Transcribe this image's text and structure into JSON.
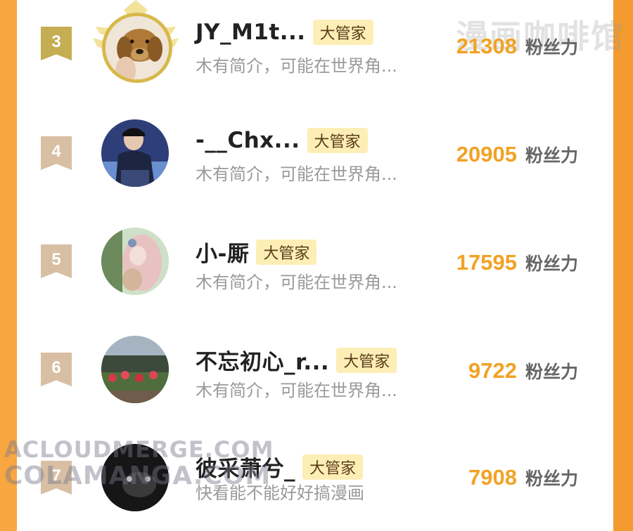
{
  "watermarks": {
    "top": "漫画咖啡馆",
    "bottom_line1": "ACLOUDMERGE.COM",
    "bottom_line2": "COLAMANGA.COM"
  },
  "fan_label": "粉丝力",
  "tag_label": "大管家",
  "colors": {
    "accent": "#f2a223",
    "gold_frame": "#d7b84b",
    "rank_badge": "#d8bfa4",
    "tag_bg": "#fdeeb6"
  },
  "rows": [
    {
      "rank": "3",
      "name": "JY_M1t...",
      "bio": "木有简介，可能在世界角...",
      "count": "21308",
      "avatar": "dog-photo"
    },
    {
      "rank": "4",
      "name": "-__Chx...",
      "bio": "木有简介，可能在世界角...",
      "count": "20905",
      "avatar": "person-cap-photo"
    },
    {
      "rank": "5",
      "name": "小-厮",
      "bio": "木有简介，可能在世界角...",
      "count": "17595",
      "avatar": "pink-hair-photo"
    },
    {
      "rank": "6",
      "name": "不忘初心_r...",
      "bio": "木有简介，可能在世界角...",
      "count": "9722",
      "avatar": "garden-photo"
    },
    {
      "rank": "7",
      "name": "彼采萧兮_",
      "bio": "快看能不能好好搞漫画",
      "count": "7908",
      "avatar": "dark-photo"
    }
  ]
}
